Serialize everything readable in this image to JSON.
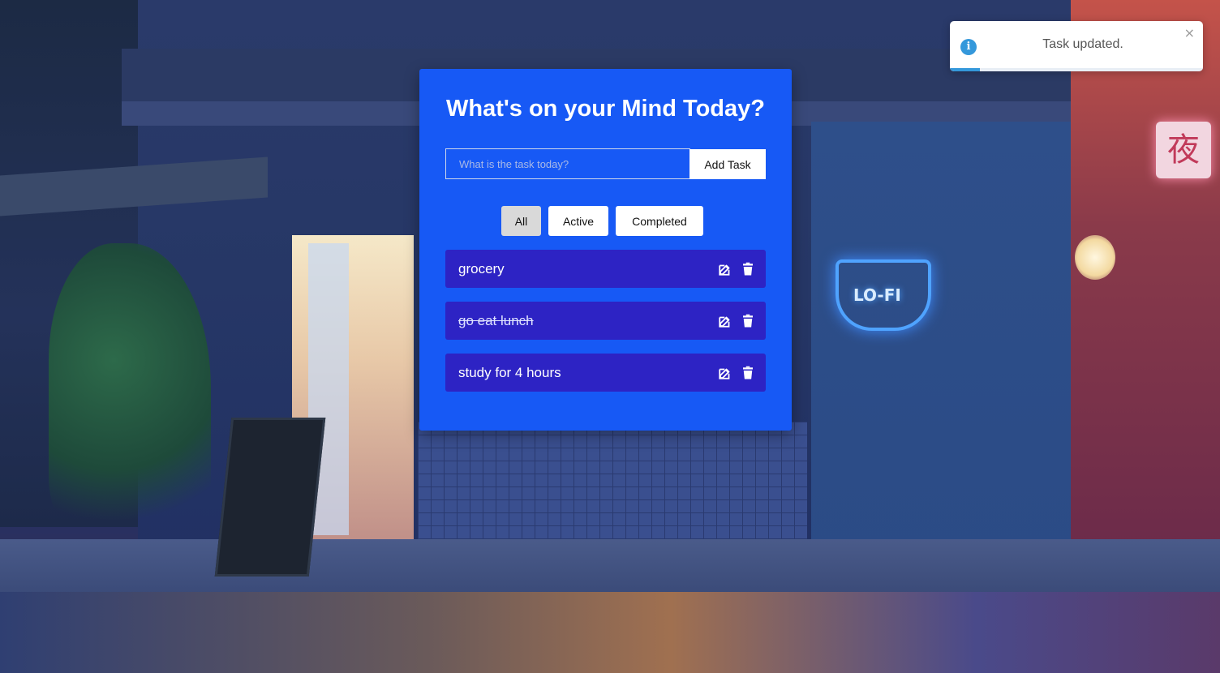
{
  "app": {
    "title": "What's on your Mind Today?"
  },
  "input": {
    "placeholder": "What is the task today?",
    "value": "",
    "add_label": "Add Task"
  },
  "filters": {
    "all": "All",
    "active": "Active",
    "completed": "Completed",
    "selected": "All"
  },
  "tasks": [
    {
      "text": "grocery",
      "completed": false
    },
    {
      "text": "go eat lunch",
      "completed": true
    },
    {
      "text": "study for 4 hours",
      "completed": false
    }
  ],
  "toast": {
    "message": "Task updated.",
    "close_glyph": "×",
    "info_glyph": "i",
    "progress": 0.12
  },
  "background": {
    "neon_sign": "LO-FI",
    "window_sign": "夜"
  },
  "colors": {
    "card": "#1759f5",
    "task_bg": "#2d23c4",
    "toast_accent": "#3498db",
    "filter_selected": "#d9d9d9"
  },
  "icons": {
    "edit": "edit-icon",
    "delete": "trash-icon",
    "info": "info-icon",
    "close": "close-icon"
  }
}
